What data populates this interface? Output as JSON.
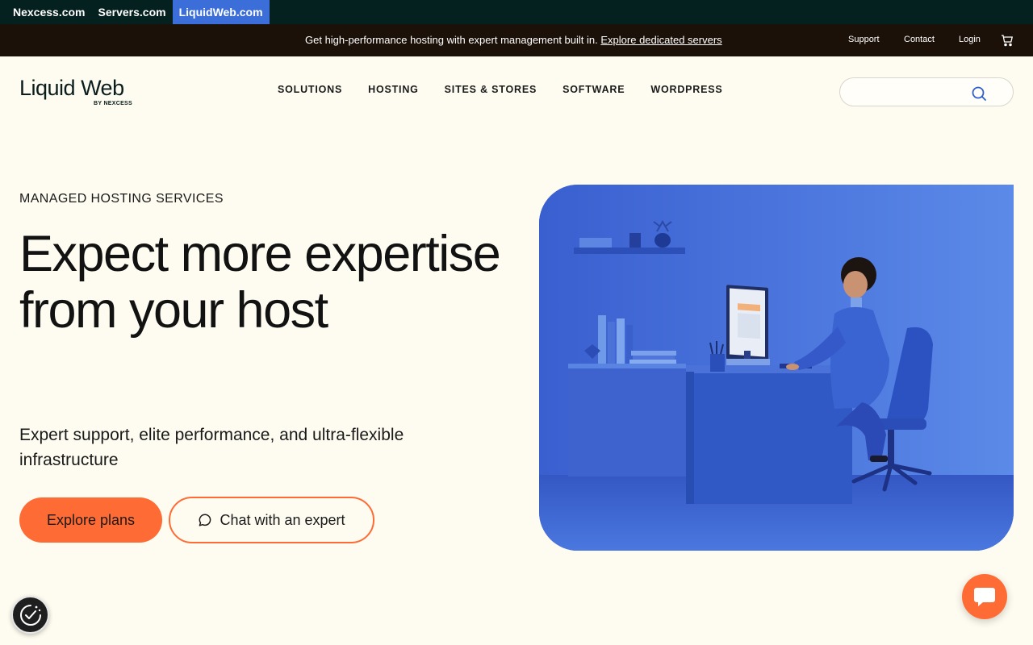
{
  "brand_bar": {
    "sites": [
      "Nexcess.com",
      "Servers.com",
      "LiquidWeb.com"
    ],
    "active_site": "LiquidWeb.com"
  },
  "promo_bar": {
    "message": "Get high-performance hosting with expert management built in.",
    "link": "Explore dedicated servers",
    "utility_links": [
      "Support",
      "Contact",
      "Login"
    ],
    "cart_icon": "cart-icon"
  },
  "header": {
    "logo_text": "Liquid Web",
    "logo_sub": "BY NEXCESS",
    "nav": [
      "SOLUTIONS",
      "HOSTING",
      "SITES & STORES",
      "SOFTWARE",
      "WORDPRESS"
    ],
    "search": {
      "placeholder": "",
      "value": "",
      "icon": "search-icon"
    }
  },
  "hero": {
    "eyebrow": "MANAGED HOSTING SERVICES",
    "headline": "Expect more expertise from your host",
    "subline": "Expert support, elite performance, and ultra-flexible infrastructure",
    "primary_cta": "Explore plans",
    "secondary_cta": "Chat with an expert",
    "image_alt": "Person working at a blue desk in a blue office"
  },
  "widgets": {
    "accessibility_icon": "accessibility-icon",
    "chat_icon": "chat-bubble-icon"
  },
  "colors": {
    "accent": "#ff6b35",
    "brand_bar_bg": "#04201f",
    "promo_bg": "#1c1109",
    "active_site_bg": "#3b6ed8",
    "page_bg": "#fefcf0"
  }
}
